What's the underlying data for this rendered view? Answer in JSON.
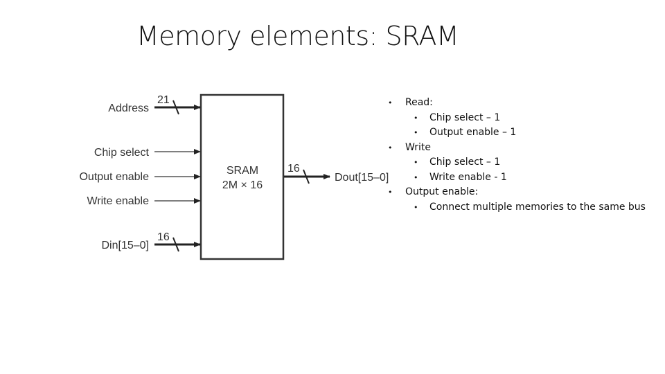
{
  "slide": {
    "title": "Memory elements: SRAM"
  },
  "diagram": {
    "block": {
      "name": "SRAM",
      "size": "2M × 16"
    },
    "inputs": [
      {
        "label": "Address",
        "bus_width": "21",
        "is_bus": true
      },
      {
        "label": "Chip select",
        "bus_width": "",
        "is_bus": false
      },
      {
        "label": "Output enable",
        "bus_width": "",
        "is_bus": false
      },
      {
        "label": "Write enable",
        "bus_width": "",
        "is_bus": false
      },
      {
        "label": "Din[15–0]",
        "bus_width": "16",
        "is_bus": true
      }
    ],
    "output": {
      "label": "Dout[15–0]",
      "bus_width": "16"
    }
  },
  "bullets": [
    {
      "level": 1,
      "text": "Read:"
    },
    {
      "level": 2,
      "text": "Chip select – 1"
    },
    {
      "level": 2,
      "text": "Output enable – 1"
    },
    {
      "level": 1,
      "text": "Write"
    },
    {
      "level": 2,
      "text": "Chip select – 1"
    },
    {
      "level": 2,
      "text": "Write enable - 1"
    },
    {
      "level": 1,
      "text": "Output enable:"
    },
    {
      "level": 2,
      "text": "Connect multiple memories to the same bus"
    }
  ],
  "bullet_glyph": "•"
}
